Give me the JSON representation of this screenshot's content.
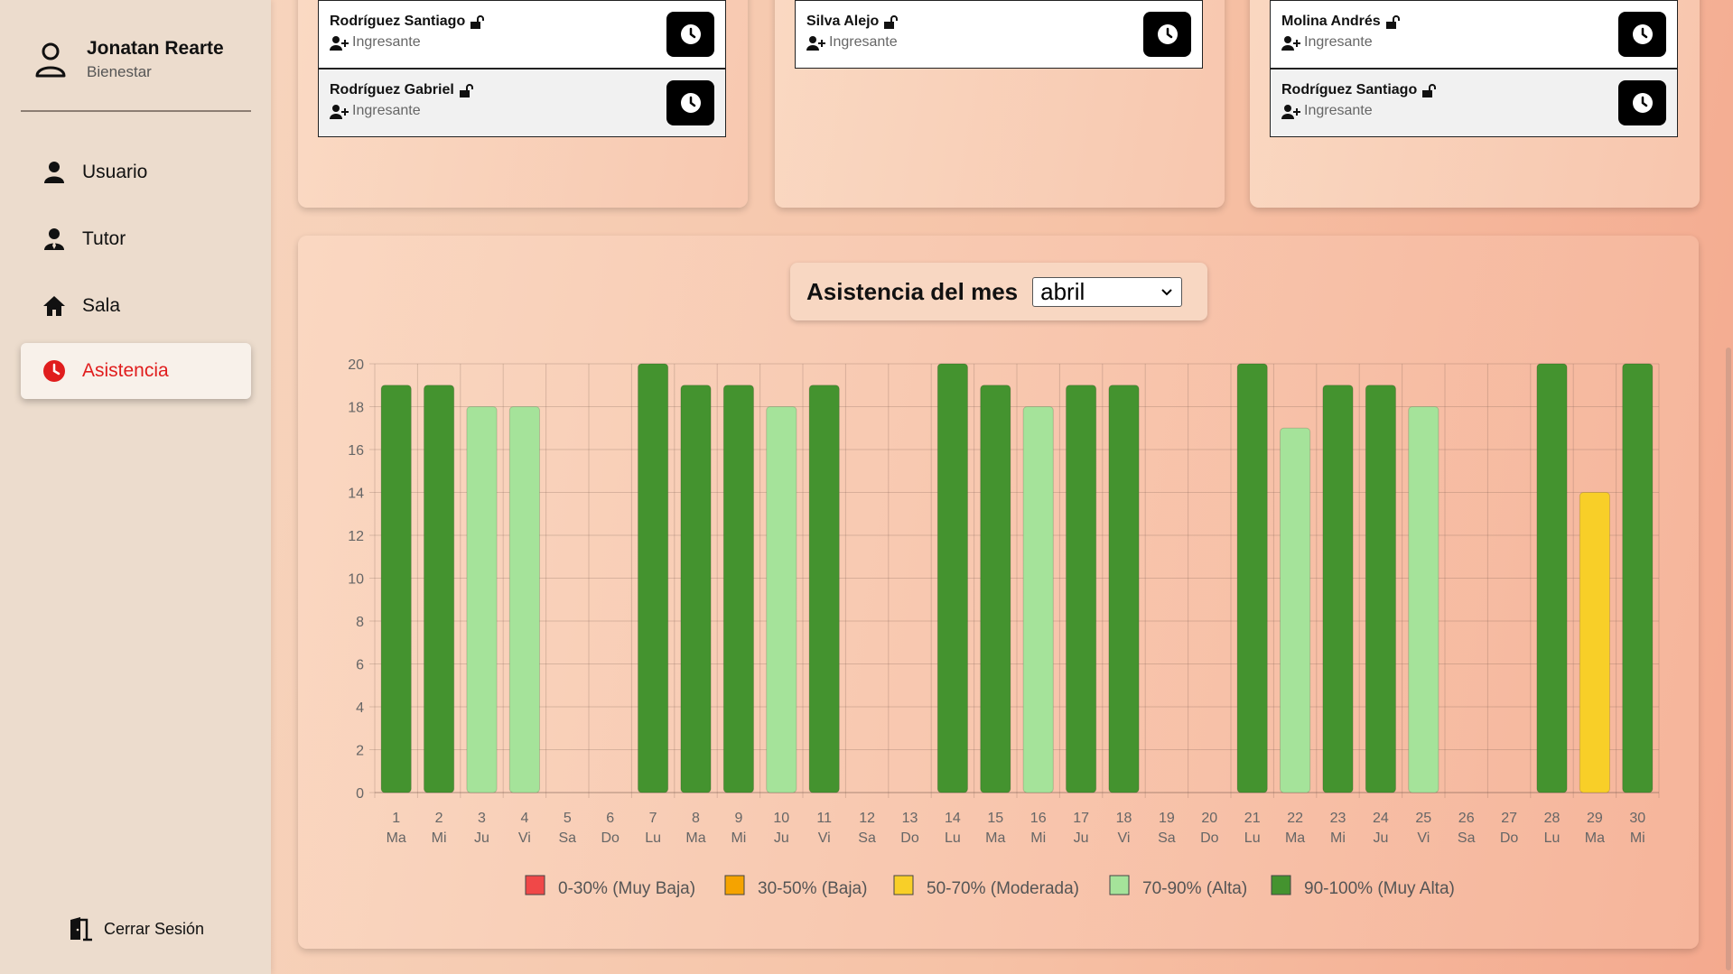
{
  "user": {
    "name": "Jonatan Rearte",
    "role": "Bienestar"
  },
  "nav": [
    {
      "label": "Usuario",
      "icon": "user-icon"
    },
    {
      "label": "Tutor",
      "icon": "tutor-icon"
    },
    {
      "label": "Sala",
      "icon": "home-icon"
    },
    {
      "label": "Asistencia",
      "icon": "clock-icon",
      "active": true
    }
  ],
  "logout_label": "Cerrar Sesión",
  "rooms": [
    {
      "entries": [
        {
          "name": "Rodríguez Santiago",
          "status": "Ingresante"
        },
        {
          "name": "Rodríguez Gabriel",
          "status": "Ingresante"
        }
      ]
    },
    {
      "entries": [
        {
          "name": "Silva Alejo",
          "status": "Ingresante"
        }
      ]
    },
    {
      "entries": [
        {
          "name": "Molina Andrés",
          "status": "Ingresante"
        },
        {
          "name": "Rodríguez Santiago",
          "status": "Ingresante"
        }
      ]
    }
  ],
  "chart_header": {
    "title": "Asistencia del mes",
    "month": "abril"
  },
  "chart_data": {
    "type": "bar",
    "categories": [
      "1",
      "2",
      "3",
      "4",
      "5",
      "6",
      "7",
      "8",
      "9",
      "10",
      "11",
      "12",
      "13",
      "14",
      "15",
      "16",
      "17",
      "18",
      "19",
      "20",
      "21",
      "22",
      "23",
      "24",
      "25",
      "26",
      "27",
      "28",
      "29",
      "30"
    ],
    "weekdays": [
      "Ma",
      "Mi",
      "Ju",
      "Vi",
      "Sa",
      "Do",
      "Lu",
      "Ma",
      "Mi",
      "Ju",
      "Vi",
      "Sa",
      "Do",
      "Lu",
      "Ma",
      "Mi",
      "Ju",
      "Vi",
      "Sa",
      "Do",
      "Lu",
      "Ma",
      "Mi",
      "Ju",
      "Vi",
      "Sa",
      "Do",
      "Lu",
      "Ma",
      "Mi"
    ],
    "values": [
      19,
      19,
      18,
      18,
      0,
      0,
      20,
      19,
      19,
      18,
      19,
      0,
      0,
      20,
      19,
      18,
      19,
      19,
      0,
      0,
      20,
      17,
      19,
      19,
      18,
      0,
      0,
      20,
      14,
      20
    ],
    "levels": [
      "90-100",
      "90-100",
      "70-90",
      "70-90",
      null,
      null,
      "90-100",
      "90-100",
      "90-100",
      "70-90",
      "90-100",
      null,
      null,
      "90-100",
      "90-100",
      "70-90",
      "90-100",
      "90-100",
      null,
      null,
      "90-100",
      "70-90",
      "90-100",
      "90-100",
      "70-90",
      null,
      null,
      "90-100",
      "50-70",
      "90-100"
    ],
    "ylim": [
      0,
      20
    ],
    "yticks": [
      0,
      2,
      4,
      6,
      8,
      10,
      12,
      14,
      16,
      18,
      20
    ],
    "grid": true,
    "legend_position": "bottom",
    "legend": [
      {
        "key": "0-30",
        "label": "0-30% (Muy Baja)",
        "color": "#f04848"
      },
      {
        "key": "30-50",
        "label": "30-50% (Baja)",
        "color": "#f5a300"
      },
      {
        "key": "50-70",
        "label": "50-70% (Moderada)",
        "color": "#f8cf28"
      },
      {
        "key": "70-90",
        "label": "70-90% (Alta)",
        "color": "#a5e39a"
      },
      {
        "key": "90-100",
        "label": "90-100% (Muy Alta)",
        "color": "#44932f"
      }
    ]
  }
}
